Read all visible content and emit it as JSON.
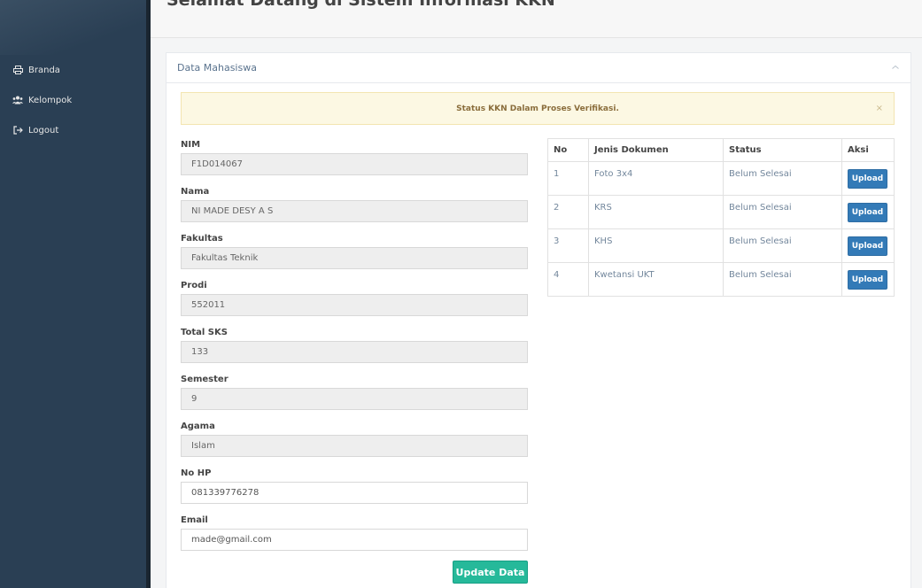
{
  "header": {
    "title": "Selamat Datang di Sistem Informasi KKN"
  },
  "sidebar": {
    "items": [
      {
        "label": "Branda",
        "icon": "printer-icon"
      },
      {
        "label": "Kelompok",
        "icon": "users-icon"
      },
      {
        "label": "Logout",
        "icon": "logout-icon"
      }
    ]
  },
  "panel": {
    "title": "Data Mahasiswa",
    "alert": {
      "text": "Status KKN Dalam Proses Verifikasi.",
      "close": "×"
    }
  },
  "form": {
    "fields": [
      {
        "label": "NIM",
        "value": "F1D014067"
      },
      {
        "label": "Nama",
        "value": "NI MADE DESY A S"
      },
      {
        "label": "Fakultas",
        "value": "Fakultas Teknik"
      },
      {
        "label": "Prodi",
        "value": "552011"
      },
      {
        "label": "Total SKS",
        "value": "133"
      },
      {
        "label": "Semester",
        "value": "9"
      },
      {
        "label": "Agama",
        "value": "Islam"
      },
      {
        "label": "No HP",
        "value": "081339776278"
      },
      {
        "label": "Email",
        "value": "made@gmail.com"
      }
    ],
    "update_label": "Update Data"
  },
  "documents": {
    "headers": [
      "No",
      "Jenis Dokumen",
      "Status",
      "Aksi"
    ],
    "rows": [
      {
        "no": "1",
        "name": "Foto 3x4",
        "status": "Belum Selesai",
        "action": "Upload"
      },
      {
        "no": "2",
        "name": "KRS",
        "status": "Belum Selesai",
        "action": "Upload"
      },
      {
        "no": "3",
        "name": "KHS",
        "status": "Belum Selesai",
        "action": "Upload"
      },
      {
        "no": "4",
        "name": "Kwetansi UKT",
        "status": "Belum Selesai",
        "action": "Upload"
      }
    ]
  },
  "colors": {
    "sidebar": "#2a3f54",
    "primary": "#337ab7",
    "success": "#26b99a",
    "alert_bg": "#fcf8e3"
  }
}
